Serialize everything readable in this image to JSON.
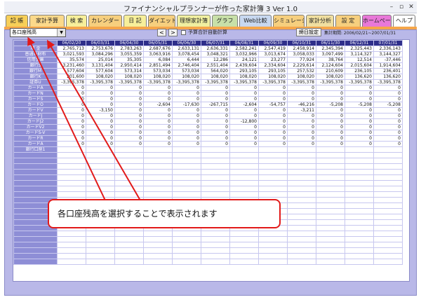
{
  "window": {
    "title": "ファイナンシャルプランナーが作った家計簿 3 Ver 1.0",
    "min": "–",
    "max": "▫",
    "close": "✕"
  },
  "tabs": [
    {
      "label": "記 帳",
      "color": "#f7cf58"
    },
    {
      "label": "家計予算",
      "color": "#fbd98a"
    },
    {
      "label": "検 索",
      "color": "#f7ef9a"
    },
    {
      "label": "カレンダー",
      "color": "#f6cf7e"
    },
    {
      "label": "日 記",
      "color": "#f7ef9a"
    },
    {
      "label": "ダイエット",
      "color": "#f6cf7e"
    },
    {
      "label": "理想家計簿",
      "color": "#f0efa0"
    },
    {
      "label": "グラフ",
      "color": "#c8e0a8"
    },
    {
      "label": "Web比較",
      "color": "#c8d8f0"
    },
    {
      "label": "シミュレーション",
      "color": "#f6cf7e"
    },
    {
      "label": "家計分析",
      "color": "#f0dfa0"
    },
    {
      "label": "設 定",
      "color": "#f6cf7e"
    },
    {
      "label": "ホームページ",
      "color": "#e878d8"
    },
    {
      "label": "ヘルプ",
      "color": "#ffffff"
    }
  ],
  "toolbar": {
    "account_select": "各口座残高",
    "prev": "<",
    "next": ">",
    "auto_calc_label": "予算合計自動計算",
    "settings_button": "締日設定",
    "period": "集計期間: 2006/02/21~2007/01/31"
  },
  "table": {
    "dates": [
      "06/02/20",
      "06/03/31",
      "06/04/30",
      "06/05/31",
      "06/06/30",
      "06/07/31",
      "06/08/31",
      "06/09/30",
      "06/10/31",
      "06/11/30",
      "06/12/31",
      "07/01/31"
    ],
    "rows": [
      {
        "label": "現 金",
        "values": [
          "2,765,713",
          "2,753,676",
          "2,783,263",
          "2,687,676",
          "2,633,131",
          "2,636,331",
          "2,582,241",
          "2,547,419",
          "2,458,914",
          "2,345,394",
          "2,325,443",
          "2,336,143"
        ]
      },
      {
        "label": "普通の財布",
        "values": [
          "3,021,593",
          "3,084,296",
          "3,055,359",
          "3,063,916",
          "3,078,454",
          "3,048,321",
          "3,032,966",
          "3,013,674",
          "3,058,033",
          "3,097,499",
          "3,114,327",
          "3,144,327"
        ]
      },
      {
        "label": "信用金庫",
        "values": [
          "35,574",
          "25,014",
          "35,305",
          "6,084",
          "6,444",
          "12,286",
          "24,121",
          "23,277",
          "77,924",
          "38,764",
          "12,514",
          "-37,446"
        ]
      },
      {
        "label": "銀行S",
        "values": [
          "3,231,460",
          "3,131,404",
          "2,950,414",
          "2,851,494",
          "2,746,404",
          "2,551,404",
          "2,439,604",
          "2,334,604",
          "2,229,614",
          "2,124,604",
          "2,015,604",
          "1,914,604"
        ]
      },
      {
        "label": "銀行M",
        "values": [
          "577,604",
          "577,604",
          "573,314",
          "573,034",
          "573,034",
          "564,020",
          "293,105",
          "293,105",
          "257,532",
          "210,609",
          "236,105",
          "236,401"
        ]
      },
      {
        "label": "銀行K",
        "values": [
          "201,600",
          "108,020",
          "108,020",
          "108,020",
          "108,020",
          "108,020",
          "108,020",
          "108,020",
          "108,020",
          "108,020",
          "136,620",
          "136,620"
        ]
      },
      {
        "label": "証券U",
        "values": [
          "-3,395,378",
          "-3,395,378",
          "-3,395,378",
          "-3,395,378",
          "-3,395,378",
          "-3,395,378",
          "-3,395,378",
          "-3,395,378",
          "-3,395,378",
          "-3,395,378",
          "-3,395,378",
          "-3,395,378"
        ]
      },
      {
        "label": "カードA",
        "values": [
          "0",
          "0",
          "0",
          "0",
          "0",
          "0",
          "0",
          "0",
          "0",
          "0",
          "0",
          "0"
        ]
      },
      {
        "label": "カードN",
        "values": [
          "0",
          "0",
          "0",
          "0",
          "0",
          "0",
          "0",
          "0",
          "0",
          "0",
          "0",
          "0"
        ]
      },
      {
        "label": "カードS",
        "values": [
          "0",
          "0",
          "0",
          "0",
          "0",
          "0",
          "0",
          "0",
          "0",
          "0",
          "0",
          "0"
        ]
      },
      {
        "label": "カードO",
        "values": [
          "0",
          "0",
          "0",
          "-2,604",
          "-17,630",
          "-267,715",
          "-2,604",
          "-54,757",
          "-46,216",
          "-5,208",
          "-5,208",
          "-5,208"
        ]
      },
      {
        "label": "カードV",
        "values": [
          "0",
          "-3,150",
          "0",
          "0",
          "0",
          "0",
          "0",
          "0",
          "-3,211",
          "0",
          "0",
          "0"
        ]
      },
      {
        "label": "カードJ",
        "values": [
          "0",
          "0",
          "0",
          "0",
          "0",
          "0",
          "0",
          "0",
          "0",
          "0",
          "0",
          "0"
        ]
      },
      {
        "label": "カードJ2",
        "values": [
          "0",
          "0",
          "0",
          "0",
          "0",
          "0",
          "-12,800",
          "0",
          "0",
          "0",
          "0",
          "0"
        ]
      },
      {
        "label": "カードV2",
        "values": [
          "0",
          "0",
          "0",
          "0",
          "0",
          "0",
          "0",
          "0",
          "0",
          "0",
          "0",
          "0"
        ]
      },
      {
        "label": "カードS-V",
        "values": [
          "0",
          "0",
          "0",
          "0",
          "0",
          "0",
          "0",
          "0",
          "0",
          "0",
          "0",
          "0"
        ]
      },
      {
        "label": "カードR",
        "values": [
          "0",
          "0",
          "0",
          "0",
          "0",
          "0",
          "0",
          "0",
          "0",
          "0",
          "0",
          "0"
        ]
      },
      {
        "label": "カードA",
        "values": [
          "0",
          "0",
          "0",
          "0",
          "0",
          "0",
          "0",
          "0",
          "0",
          "0",
          "0",
          "0"
        ]
      },
      {
        "label": "銀行口座1",
        "values": [
          "",
          "",
          "",
          "",
          "",
          "",
          "",
          "",
          "",
          "",
          "",
          ""
        ]
      }
    ]
  },
  "callout": {
    "text": "各口座残高を選択することで表示されます",
    "border_color": "#e21a1a"
  },
  "colors": {
    "panel": "#b9b8e8",
    "header": "#2e2e8a",
    "rowlabel": "#8e8ed6",
    "accent_strip": "#f5a64a"
  }
}
